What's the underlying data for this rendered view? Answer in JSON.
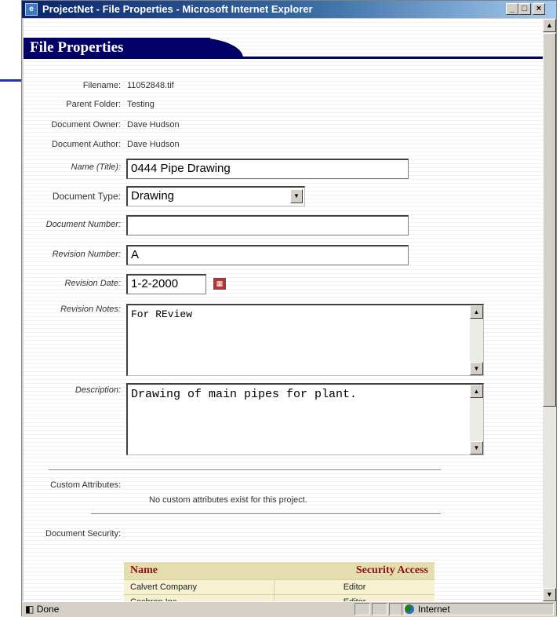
{
  "window": {
    "title": "ProjectNet - File Properties - Microsoft Internet Explorer",
    "buttons": [
      "_",
      "□",
      "×"
    ]
  },
  "page": {
    "heading": "File Properties",
    "fields": {
      "filename": {
        "label": "Filename:",
        "value": "11052848.tif"
      },
      "parent_folder": {
        "label": "Parent Folder:",
        "value": "Testing"
      },
      "document_owner": {
        "label": "Document Owner:",
        "value": "Dave Hudson"
      },
      "document_author": {
        "label": "Document Author:",
        "value": "Dave Hudson"
      },
      "name_title": {
        "label": "Name (Title):",
        "value": "0444 Pipe Drawing"
      },
      "document_type": {
        "label": "Document Type:",
        "value": "Drawing"
      },
      "document_number": {
        "label": "Document Number:",
        "value": ""
      },
      "revision_number": {
        "label": "Revision Number:",
        "value": "A"
      },
      "revision_date": {
        "label": "Revision Date:",
        "value": "1-2-2000"
      },
      "revision_notes": {
        "label": "Revision Notes:",
        "value": "For REview"
      },
      "description": {
        "label": "Description:",
        "value": "Drawing of main pipes for plant."
      }
    },
    "custom_attributes": {
      "label": "Custom Attributes:",
      "message": "No custom attributes exist for this project."
    },
    "document_security": {
      "label": "Document Security:",
      "columns": [
        "Name",
        "Security Access"
      ],
      "rows": [
        [
          "Calvert Company",
          "Editor"
        ],
        [
          "Cechren Inc",
          "Editor"
        ]
      ]
    }
  },
  "status": {
    "text": "Done",
    "zone": "Internet"
  },
  "icons": {
    "calendar": "calendar-icon",
    "globe": "internet-zone-icon",
    "dropdown": "chevron-down-icon"
  }
}
